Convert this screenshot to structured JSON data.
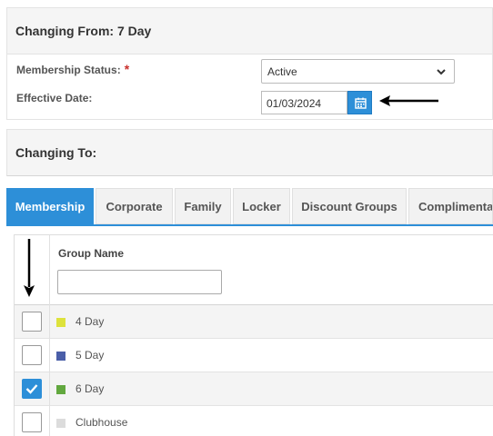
{
  "changing_from": {
    "title": "Changing From: 7 Day",
    "membership_status_label": "Membership Status:",
    "required_marker": "*",
    "membership_status_value": "Active",
    "effective_date_label": "Effective Date:",
    "effective_date_value": "01/03/2024"
  },
  "changing_to": {
    "title": "Changing To:"
  },
  "tabs": [
    {
      "label": "Membership",
      "active": true
    },
    {
      "label": "Corporate",
      "active": false
    },
    {
      "label": "Family",
      "active": false
    },
    {
      "label": "Locker",
      "active": false
    },
    {
      "label": "Discount Groups",
      "active": false
    },
    {
      "label": "Complimentary",
      "active": false
    }
  ],
  "grid": {
    "column_header": "Group Name",
    "filter_value": "",
    "rows": [
      {
        "label": "4 Day",
        "color": "#dde23c",
        "checked": false
      },
      {
        "label": "5 Day",
        "color": "#4a5ea8",
        "checked": false
      },
      {
        "label": "6 Day",
        "color": "#62a83f",
        "checked": true
      },
      {
        "label": "Clubhouse",
        "color": "#dcdcdc",
        "checked": false
      }
    ]
  },
  "colors": {
    "accent": "#2d8fd8",
    "required": "#c9302c"
  },
  "icons": {
    "dropdown": "chevron-down-icon",
    "calendar": "calendar-icon",
    "checkbox_checked": "checkmark-icon"
  }
}
